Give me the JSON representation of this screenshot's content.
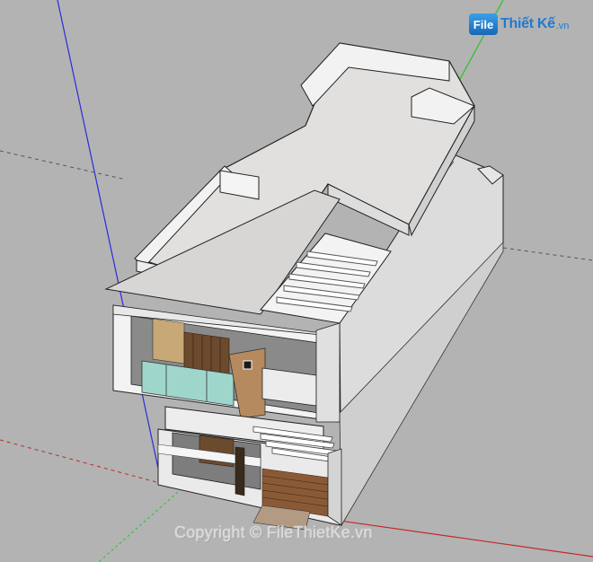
{
  "watermark": {
    "logo_icon_text": "File",
    "logo_text": "Thiết Kế",
    "logo_suffix": ".vn",
    "copyright": "Copyright © FileThietKe.vn"
  },
  "colors": {
    "background": "#b3b3b3",
    "axis_blue": "#2b2bd9",
    "axis_green": "#27c427",
    "axis_red": "#c42727",
    "logo_blue": "#1f7ad1"
  },
  "scene": {
    "description_icon": "sketchup-3d-model-viewport"
  }
}
